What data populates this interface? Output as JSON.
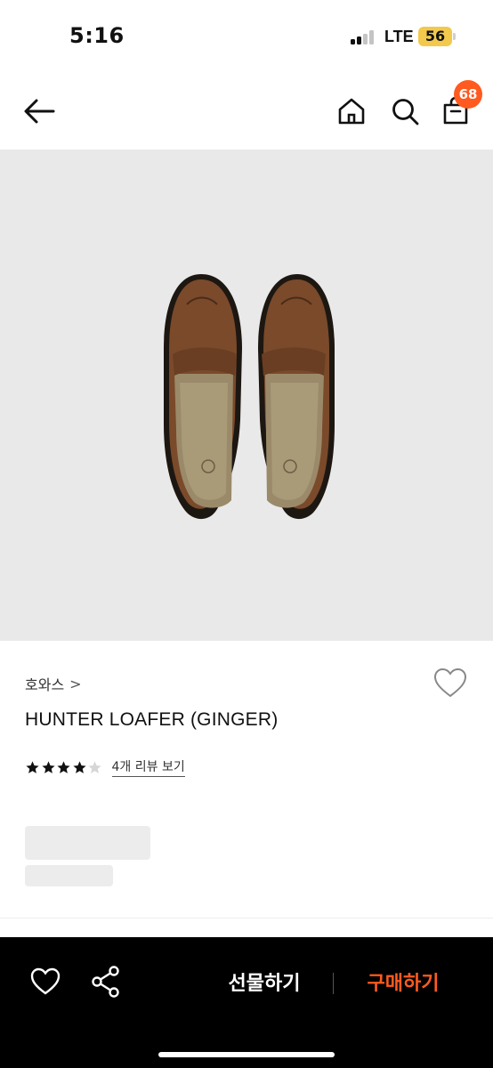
{
  "status_bar": {
    "time": "5:16",
    "network": "LTE",
    "battery": "56"
  },
  "nav": {
    "cart_count": "68"
  },
  "product": {
    "brand": "호와스",
    "brand_chevron": ">",
    "name": "HUNTER LOAFER (GINGER)",
    "rating": 4,
    "rating_max": 5,
    "review_link": "4개 리뷰 보기"
  },
  "bottom_bar": {
    "gift_label": "선물하기",
    "buy_label": "구매하기"
  },
  "colors": {
    "accent": "#ff5a1f",
    "battery": "#f2c94c",
    "image_bg": "#e9e9e9"
  }
}
